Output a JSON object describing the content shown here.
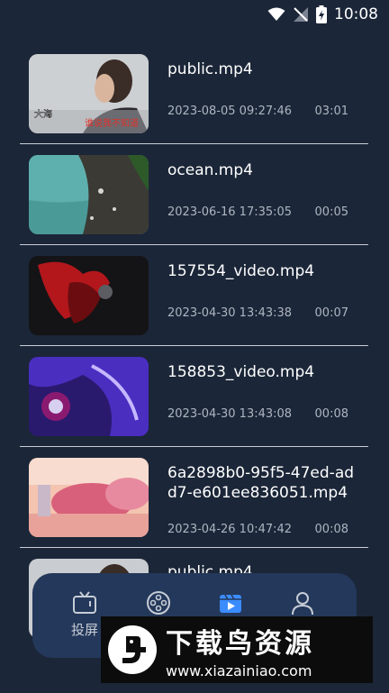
{
  "status_bar": {
    "time": "10:08"
  },
  "videos": [
    {
      "name": "public.mp4",
      "date": "2023-08-05 09:27:46",
      "duration": "03:01"
    },
    {
      "name": "ocean.mp4",
      "date": "2023-06-16 17:35:05",
      "duration": "00:05"
    },
    {
      "name": "157554_video.mp4",
      "date": "2023-04-30 13:43:38",
      "duration": "00:07"
    },
    {
      "name": "158853_video.mp4",
      "date": "2023-04-30 13:43:08",
      "duration": "00:08"
    },
    {
      "name": "6a2898b0-95f5-47ed-add7-e601ee836051.mp4",
      "date": "2023-04-26 10:47:42",
      "duration": "00:08"
    },
    {
      "name": "public.mp4"
    }
  ],
  "thumbnail_captions": {
    "left": "大海",
    "right": "谁说我不知道"
  },
  "bottom_nav": {
    "items": [
      {
        "label": "投屏",
        "icon": "tv-icon"
      },
      {
        "label": "",
        "icon": "film-reel-icon"
      },
      {
        "label": "",
        "icon": "video-clapper-icon",
        "active": true
      },
      {
        "label": "",
        "icon": "person-icon"
      }
    ]
  },
  "watermark": {
    "title": "下载鸟资源",
    "url": "www.xiazainiao.com"
  },
  "colors": {
    "background": "#1b2638",
    "nav_bg": "#23385a",
    "active": "#3b8cff",
    "meta_text": "#aeb5c0"
  }
}
